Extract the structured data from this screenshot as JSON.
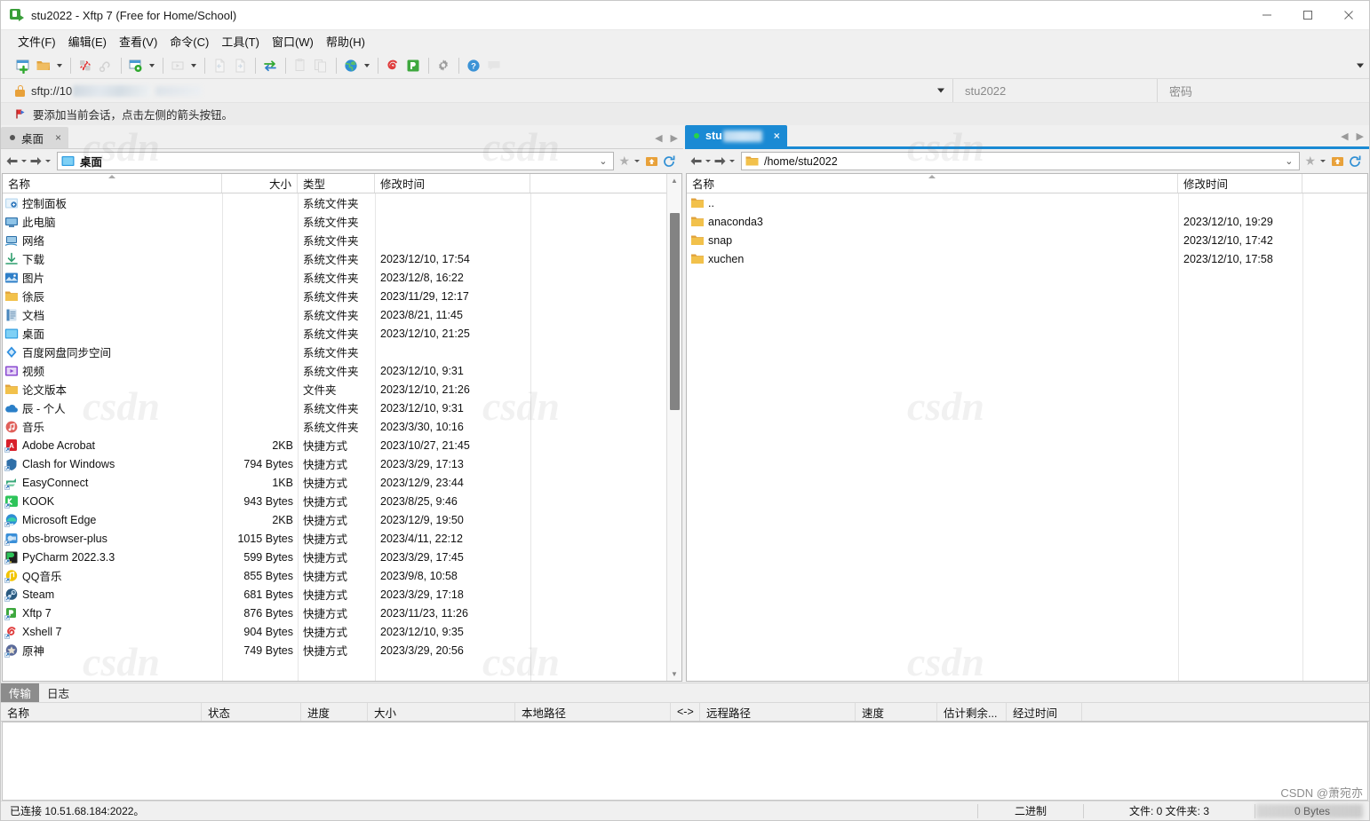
{
  "window": {
    "title": "stu2022 - Xftp 7 (Free for Home/School)",
    "app_icon": "xftp-icon",
    "minimize": "—",
    "maximize": "□",
    "close": "✕"
  },
  "menubar": [
    {
      "label": "文件(F)",
      "name": "menu-file"
    },
    {
      "label": "编辑(E)",
      "name": "menu-edit"
    },
    {
      "label": "查看(V)",
      "name": "menu-view"
    },
    {
      "label": "命令(C)",
      "name": "menu-command"
    },
    {
      "label": "工具(T)",
      "name": "menu-tools"
    },
    {
      "label": "窗口(W)",
      "name": "menu-window"
    },
    {
      "label": "帮助(H)",
      "name": "menu-help"
    }
  ],
  "session_bar": {
    "url_prefix": "sftp://10",
    "username_value": "stu2022",
    "password_placeholder": "密码"
  },
  "notice": {
    "text": "要添加当前会话，点击左侧的箭头按钮。"
  },
  "left_panel": {
    "tab": {
      "label": "桌面",
      "close": "×"
    },
    "address": "桌面",
    "columns": [
      {
        "key": "name",
        "label": "名称"
      },
      {
        "key": "size",
        "label": "大小"
      },
      {
        "key": "type",
        "label": "类型"
      },
      {
        "key": "time",
        "label": "修改时间"
      }
    ],
    "files": [
      {
        "name": "控制面板",
        "size": "",
        "type": "系统文件夹",
        "time": "",
        "icon": "control-panel-icon"
      },
      {
        "name": "此电脑",
        "size": "",
        "type": "系统文件夹",
        "time": "",
        "icon": "this-pc-icon"
      },
      {
        "name": "网络",
        "size": "",
        "type": "系统文件夹",
        "time": "",
        "icon": "network-icon"
      },
      {
        "name": "下载",
        "size": "",
        "type": "系统文件夹",
        "time": "2023/12/10, 17:54",
        "icon": "downloads-icon"
      },
      {
        "name": "图片",
        "size": "",
        "type": "系统文件夹",
        "time": "2023/12/8, 16:22",
        "icon": "pictures-icon"
      },
      {
        "name": "徐辰",
        "size": "",
        "type": "系统文件夹",
        "time": "2023/11/29, 12:17",
        "icon": "folder-icon"
      },
      {
        "name": "文档",
        "size": "",
        "type": "系统文件夹",
        "time": "2023/8/21, 11:45",
        "icon": "documents-icon"
      },
      {
        "name": "桌面",
        "size": "",
        "type": "系统文件夹",
        "time": "2023/12/10, 21:25",
        "icon": "desktop-icon"
      },
      {
        "name": "百度网盘同步空间",
        "size": "",
        "type": "系统文件夹",
        "time": "",
        "icon": "baidu-netdisk-icon"
      },
      {
        "name": "视频",
        "size": "",
        "type": "系统文件夹",
        "time": "2023/12/10, 9:31",
        "icon": "videos-icon"
      },
      {
        "name": "论文版本",
        "size": "",
        "type": "文件夹",
        "time": "2023/12/10, 21:26",
        "icon": "folder-icon"
      },
      {
        "name": "辰 - 个人",
        "size": "",
        "type": "系统文件夹",
        "time": "2023/12/10, 9:31",
        "icon": "onedrive-icon"
      },
      {
        "name": "音乐",
        "size": "",
        "type": "系统文件夹",
        "time": "2023/3/30, 10:16",
        "icon": "music-icon"
      },
      {
        "name": "Adobe Acrobat",
        "size": "2KB",
        "type": "快捷方式",
        "time": "2023/10/27, 21:45",
        "icon": "adobe-acrobat-icon"
      },
      {
        "name": "Clash for Windows",
        "size": "794 Bytes",
        "type": "快捷方式",
        "time": "2023/3/29, 17:13",
        "icon": "clash-icon"
      },
      {
        "name": "EasyConnect",
        "size": "1KB",
        "type": "快捷方式",
        "time": "2023/12/9, 23:44",
        "icon": "easyconnect-icon"
      },
      {
        "name": "KOOK",
        "size": "943 Bytes",
        "type": "快捷方式",
        "time": "2023/8/25, 9:46",
        "icon": "kook-icon"
      },
      {
        "name": "Microsoft Edge",
        "size": "2KB",
        "type": "快捷方式",
        "time": "2023/12/9, 19:50",
        "icon": "edge-icon"
      },
      {
        "name": "obs-browser-plus",
        "size": "1015 Bytes",
        "type": "快捷方式",
        "time": "2023/4/11, 22:12",
        "icon": "obs-icon"
      },
      {
        "name": "PyCharm 2022.3.3",
        "size": "599 Bytes",
        "type": "快捷方式",
        "time": "2023/3/29, 17:45",
        "icon": "pycharm-icon"
      },
      {
        "name": "QQ音乐",
        "size": "855 Bytes",
        "type": "快捷方式",
        "time": "2023/9/8, 10:58",
        "icon": "qqmusic-icon"
      },
      {
        "name": "Steam",
        "size": "681 Bytes",
        "type": "快捷方式",
        "time": "2023/3/29, 17:18",
        "icon": "steam-icon"
      },
      {
        "name": "Xftp 7",
        "size": "876 Bytes",
        "type": "快捷方式",
        "time": "2023/11/23, 11:26",
        "icon": "xftp-icon"
      },
      {
        "name": "Xshell 7",
        "size": "904 Bytes",
        "type": "快捷方式",
        "time": "2023/12/10, 9:35",
        "icon": "xshell-icon"
      },
      {
        "name": "原神",
        "size": "749 Bytes",
        "type": "快捷方式",
        "time": "2023/3/29, 20:56",
        "icon": "genshin-icon"
      }
    ]
  },
  "right_panel": {
    "tab": {
      "label": "stu",
      "close": "×"
    },
    "address": "/home/stu2022",
    "columns": [
      {
        "key": "name",
        "label": "名称"
      },
      {
        "key": "time",
        "label": "修改时间"
      }
    ],
    "files": [
      {
        "name": "..",
        "time": "",
        "icon": "folder-up-icon"
      },
      {
        "name": "anaconda3",
        "time": "2023/12/10, 19:29",
        "icon": "folder-icon"
      },
      {
        "name": "snap",
        "time": "2023/12/10, 17:42",
        "icon": "folder-icon"
      },
      {
        "name": "xuchen",
        "time": "2023/12/10, 17:58",
        "icon": "folder-icon"
      }
    ]
  },
  "transfer": {
    "tabs": [
      {
        "label": "传输",
        "active": true
      },
      {
        "label": "日志",
        "active": false
      }
    ],
    "columns": [
      {
        "label": "名称"
      },
      {
        "label": "状态"
      },
      {
        "label": "进度"
      },
      {
        "label": "大小"
      },
      {
        "label": "本地路径"
      },
      {
        "label": "<->"
      },
      {
        "label": "远程路径"
      },
      {
        "label": "速度"
      },
      {
        "label": "估计剩余..."
      },
      {
        "label": "经过时间"
      }
    ],
    "rows": []
  },
  "status_bar": {
    "connection": "已连接 10.51.68.184:2022。",
    "mode": "二进制",
    "counts": "文件: 0 文件夹: 3",
    "bytes": "0 Bytes"
  },
  "watermark": {
    "text": "csdn",
    "credit": "CSDN @萧宛亦"
  },
  "colors": {
    "accent": "#1a8ad4",
    "folder": "#f2c14b",
    "tab_active_bg": "#1a8ad4",
    "toolbar_bg": "#f0f0f0"
  }
}
